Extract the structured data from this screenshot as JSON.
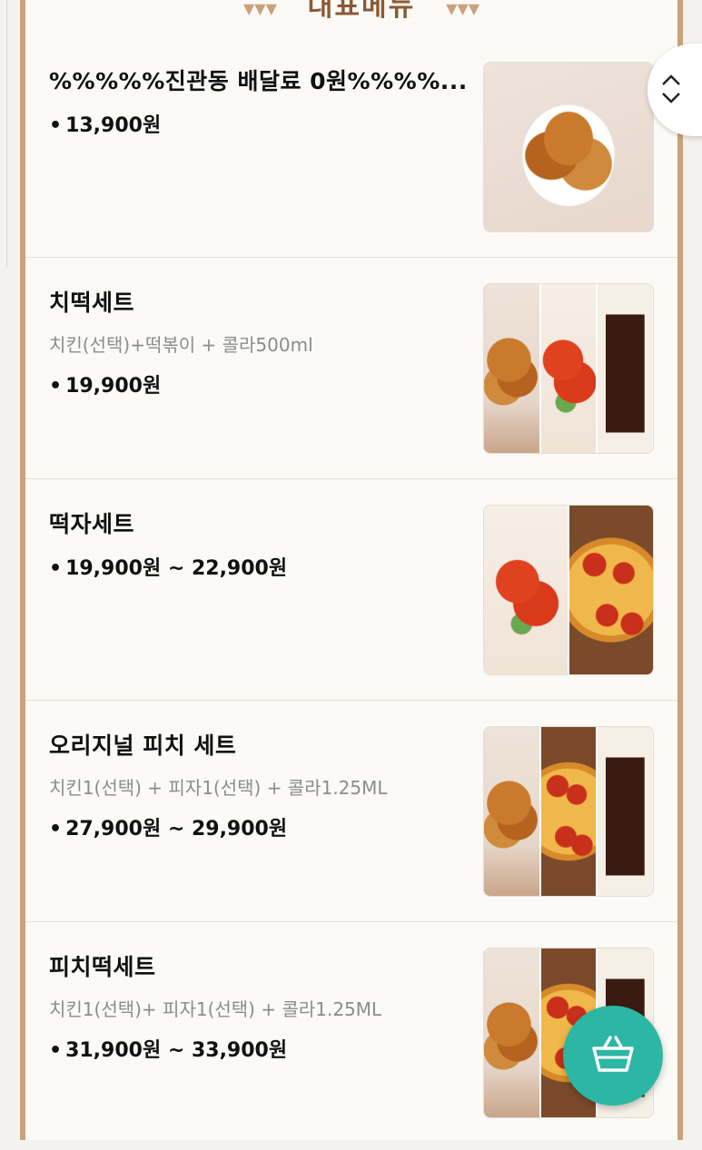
{
  "header": {
    "title": "대표메뉴"
  },
  "menu_items": [
    {
      "name": "%%%%%진관동 배달료 0원%%%%...",
      "description": "",
      "price": "13,900원",
      "image_icon": "chicken-photo"
    },
    {
      "name": "치떡세트",
      "description": "치킨(선택)+떡볶이 + 콜라500ml",
      "price": "19,900원",
      "image_icon": "chicken-tteokbokki-cola-photo"
    },
    {
      "name": "떡자세트",
      "description": "",
      "price": "19,900원 ~ 22,900원",
      "image_icon": "tteokbokki-pizza-photo"
    },
    {
      "name": "오리지널 피치 세트",
      "description": "치킨1(선택) + 피자1(선택) + 콜라1.25ML",
      "price": "27,900원 ~ 29,900원",
      "image_icon": "chicken-pizza-cola-photo"
    },
    {
      "name": "피치떡세트",
      "description": "치킨1(선택)+ 피자1(선택) + 콜라1.25ML",
      "price": "31,900원 ~ 33,900원",
      "image_icon": "chicken-pizza-cola-photo"
    }
  ],
  "price_bullet": "•",
  "nav": {
    "up_icon": "chevron-up-icon",
    "down_icon": "chevron-down-icon"
  },
  "cart": {
    "icon": "basket-icon",
    "color": "#2bb7a3"
  },
  "colors": {
    "frame": "#c9a27a",
    "background": "#fbfaf7",
    "text": "#111111",
    "description": "#8c8c8c"
  }
}
